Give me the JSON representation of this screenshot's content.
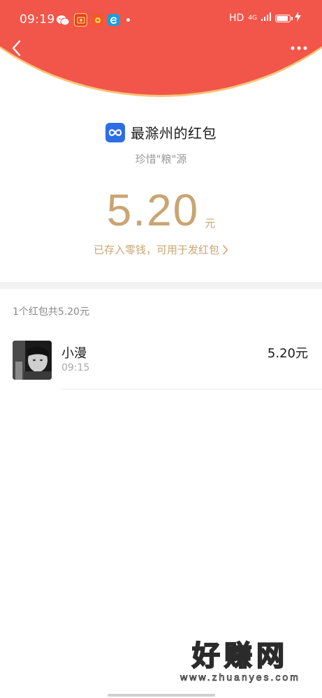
{
  "status_bar": {
    "time": "09:19",
    "hd_label": "HD",
    "network_label": "4G",
    "app_icons": [
      "wechat-icon",
      "app-icon-red-square",
      "app-icon-orange",
      "app-icon-blue-e"
    ]
  },
  "header": {
    "back_icon": "chevron-left-icon",
    "more_icon": "more-dots-icon",
    "background_color": "#f2564a",
    "border_color": "#f7c478"
  },
  "envelope": {
    "sender_logo": "infinity-logo-icon",
    "sender_title": "最滁州的红包",
    "wish": "珍惜\"粮\"源",
    "amount": "5.20",
    "unit": "元",
    "deposit_text": "已存入零钱，可用于发红包",
    "accent_color": "#c9a573"
  },
  "summary": {
    "text": "1个红包共5.20元"
  },
  "receivers": [
    {
      "name": "小漫",
      "time": "09:15",
      "amount": "5.20元"
    }
  ],
  "watermark": {
    "title": "好赚网",
    "url": "www.zhuanyes.com"
  }
}
